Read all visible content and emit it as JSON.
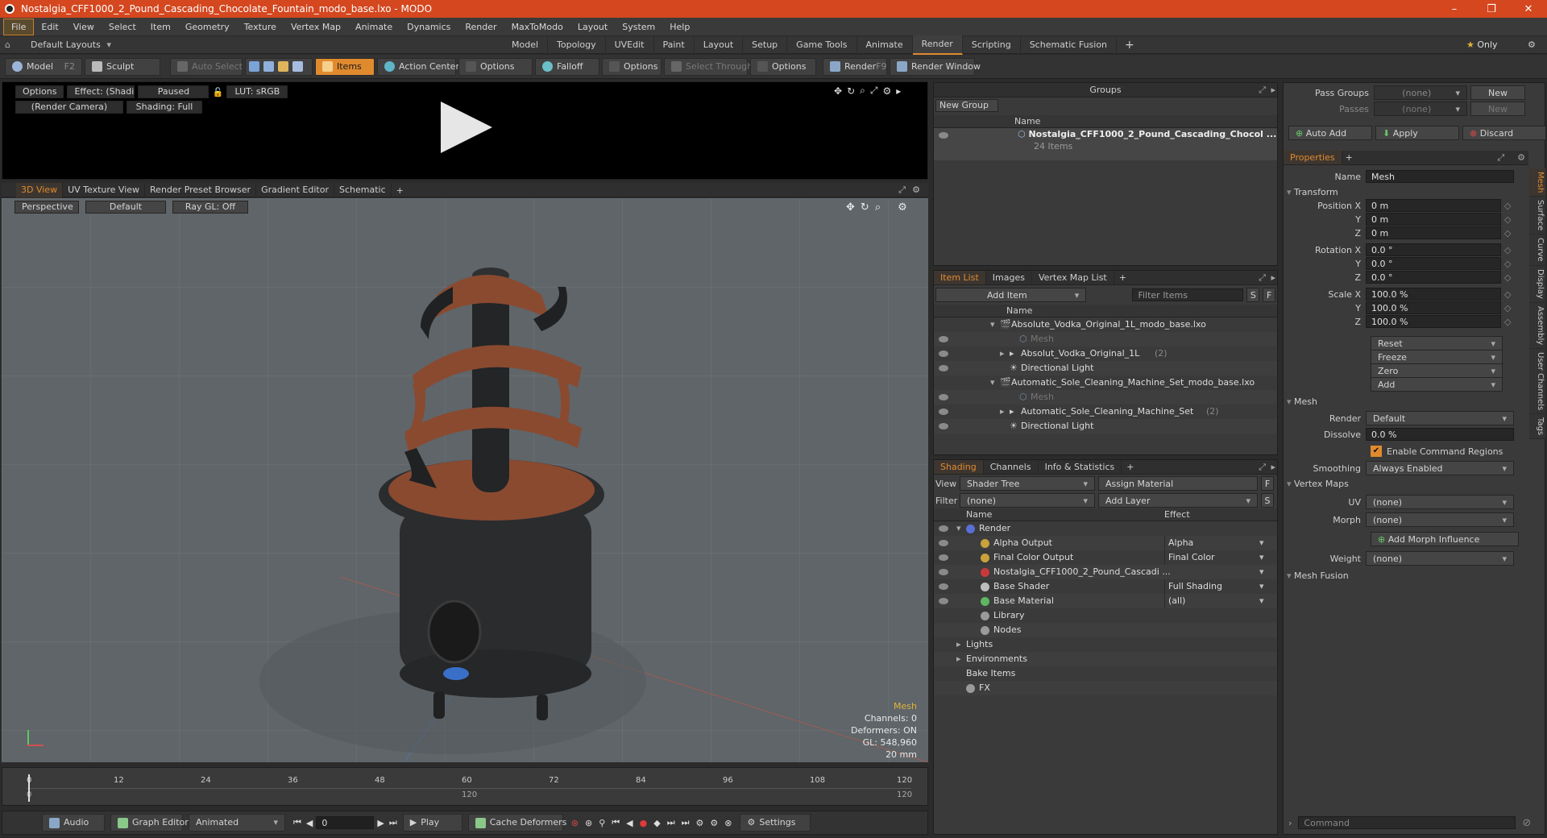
{
  "window": {
    "title": "Nostalgia_CFF1000_2_Pound_Cascading_Chocolate_Fountain_modo_base.lxo - MODO",
    "minimize": "–",
    "restore": "❐",
    "close": "✕"
  },
  "menu": [
    "File",
    "Edit",
    "View",
    "Select",
    "Item",
    "Geometry",
    "Texture",
    "Vertex Map",
    "Animate",
    "Dynamics",
    "Render",
    "MaxToModo",
    "Layout",
    "System",
    "Help"
  ],
  "layouts": {
    "dropdown": "Default Layouts",
    "tabs": [
      "Model",
      "Topology",
      "UVEdit",
      "Paint",
      "Layout",
      "Setup",
      "Game Tools",
      "Animate",
      "Render",
      "Scripting",
      "Schematic Fusion"
    ],
    "active": "Render",
    "plus": "+",
    "only": "Only"
  },
  "toolbar": {
    "model": "Model",
    "model_key": "F2",
    "sculpt": "Sculpt",
    "auto_select": "Auto Select",
    "items": "Items",
    "action_center": "Action Center",
    "options1": "Options",
    "falloff": "Falloff",
    "options2": "Options",
    "select_through": "Select Through",
    "options3": "Options",
    "render": "Render",
    "render_key": "F9",
    "render_window": "Render Window"
  },
  "preview": {
    "options": "Options",
    "effect": "Effect: (Shadi...",
    "paused": "Paused",
    "lut": "LUT: sRGB",
    "camera": "(Render Camera)",
    "shading": "Shading: Full"
  },
  "viewport": {
    "tabs": [
      "3D View",
      "UV Texture View",
      "Render Preset Browser",
      "Gradient Editor",
      "Schematic"
    ],
    "plus": "+",
    "perspective": "Perspective",
    "default": "Default",
    "raygl": "Ray GL: Off",
    "info": {
      "mesh": "Mesh",
      "channels": "Channels: 0",
      "deformers": "Deformers: ON",
      "gl": "GL: 548,960",
      "size": "20 mm"
    }
  },
  "timeline": {
    "ticks": [
      "0",
      "12",
      "24",
      "36",
      "48",
      "60",
      "72",
      "84",
      "96",
      "108",
      "120"
    ],
    "sub_ticks": [
      "0",
      "120",
      "120"
    ]
  },
  "bottombar": {
    "audio": "Audio",
    "graph_editor": "Graph Editor",
    "animated": "Animated",
    "frame": "0",
    "play": "Play",
    "cache": "Cache Deformers",
    "settings": "Settings"
  },
  "groups": {
    "title": "Groups",
    "new_group": "New Group",
    "col_name": "Name",
    "item_name": "Nostalgia_CFF1000_2_Pound_Cascading_Chocol ...",
    "item_count": "24 Items"
  },
  "itemlist": {
    "tabs": [
      "Item List",
      "Images",
      "Vertex Map List"
    ],
    "plus": "+",
    "add_item": "Add Item",
    "filter": "Filter Items",
    "s": "S",
    "f": "F",
    "col_name": "Name",
    "rows": [
      {
        "label": "Absolute_Vodka_Original_1L_modo_base.lxo",
        "indent": 0,
        "kind": "scene",
        "count": ""
      },
      {
        "label": "Mesh",
        "indent": 2,
        "kind": "mesh-dim",
        "count": ""
      },
      {
        "label": "Absolut_Vodka_Original_1L",
        "indent": 1,
        "kind": "group",
        "count": "(2)"
      },
      {
        "label": "Directional Light",
        "indent": 1,
        "kind": "light",
        "count": ""
      },
      {
        "label": "Automatic_Sole_Cleaning_Machine_Set_modo_base.lxo",
        "indent": 0,
        "kind": "scene",
        "count": ""
      },
      {
        "label": "Mesh",
        "indent": 2,
        "kind": "mesh-dim",
        "count": ""
      },
      {
        "label": "Automatic_Sole_Cleaning_Machine_Set",
        "indent": 1,
        "kind": "group",
        "count": "(2)"
      },
      {
        "label": "Directional Light",
        "indent": 1,
        "kind": "light",
        "count": ""
      }
    ]
  },
  "shading": {
    "tabs": [
      "Shading",
      "Channels",
      "Info & Statistics"
    ],
    "plus": "+",
    "view_label": "View",
    "view_value": "Shader Tree",
    "assign": "Assign Material",
    "filter_label": "Filter",
    "filter_value": "(none)",
    "add_layer": "Add Layer",
    "col_name": "Name",
    "col_effect": "Effect",
    "rows": [
      {
        "name": "Render",
        "effect": "",
        "indent": 0,
        "color": "#5a6fd6"
      },
      {
        "name": "Alpha Output",
        "effect": "Alpha",
        "indent": 1,
        "color": "#c8a23a"
      },
      {
        "name": "Final Color Output",
        "effect": "Final Color",
        "indent": 1,
        "color": "#c8a23a"
      },
      {
        "name": "Nostalgia_CFF1000_2_Pound_Cascadi ...",
        "effect": "",
        "indent": 1,
        "color": "#c83a3a"
      },
      {
        "name": "Base Shader",
        "effect": "Full Shading",
        "indent": 1,
        "color": "#bdbdbd"
      },
      {
        "name": "Base Material",
        "effect": "(all)",
        "indent": 1,
        "color": "#5fb85f"
      },
      {
        "name": "Library",
        "effect": "",
        "indent": 1,
        "color": "#9a9a9a"
      },
      {
        "name": "Nodes",
        "effect": "",
        "indent": 1,
        "color": "#9a9a9a"
      },
      {
        "name": "Lights",
        "effect": "",
        "indent": 0,
        "color": ""
      },
      {
        "name": "Environments",
        "effect": "",
        "indent": 0,
        "color": ""
      },
      {
        "name": "Bake Items",
        "effect": "",
        "indent": 0,
        "color": ""
      },
      {
        "name": "FX",
        "effect": "",
        "indent": 0,
        "color": "#9a9a9a"
      }
    ]
  },
  "props": {
    "pass_groups": "Pass Groups",
    "passes": "Passes",
    "none": "(none)",
    "new": "New",
    "auto_add": "Auto Add",
    "apply": "Apply",
    "discard": "Discard",
    "tab": "Properties",
    "plus": "+",
    "name_label": "Name",
    "name_value": "Mesh",
    "transform": "Transform",
    "position_x": "Position X",
    "rotation_x": "Rotation X",
    "scale_x": "Scale X",
    "y": "Y",
    "z": "Z",
    "pos": [
      "0 m",
      "0 m",
      "0 m"
    ],
    "rot": [
      "0.0 °",
      "0.0 °",
      "0.0 °"
    ],
    "scale": [
      "100.0 %",
      "100.0 %",
      "100.0 %"
    ],
    "reset": "Reset",
    "freeze": "Freeze",
    "zero": "Zero",
    "add": "Add",
    "mesh": "Mesh",
    "render_label": "Render",
    "render_value": "Default",
    "dissolve_label": "Dissolve",
    "dissolve_value": "0.0 %",
    "enable_cmd": "Enable Command Regions",
    "smoothing_label": "Smoothing",
    "smoothing_value": "Always Enabled",
    "vertex_maps": "Vertex Maps",
    "uv_label": "UV",
    "morph_label": "Morph",
    "add_morph": "Add Morph Influence",
    "weight_label": "Weight",
    "mesh_fusion": "Mesh Fusion",
    "side_tabs": [
      "Mesh",
      "Surface",
      "Curve",
      "Display",
      "Assembly",
      "User Channels",
      "Tags"
    ],
    "command": "Command"
  }
}
